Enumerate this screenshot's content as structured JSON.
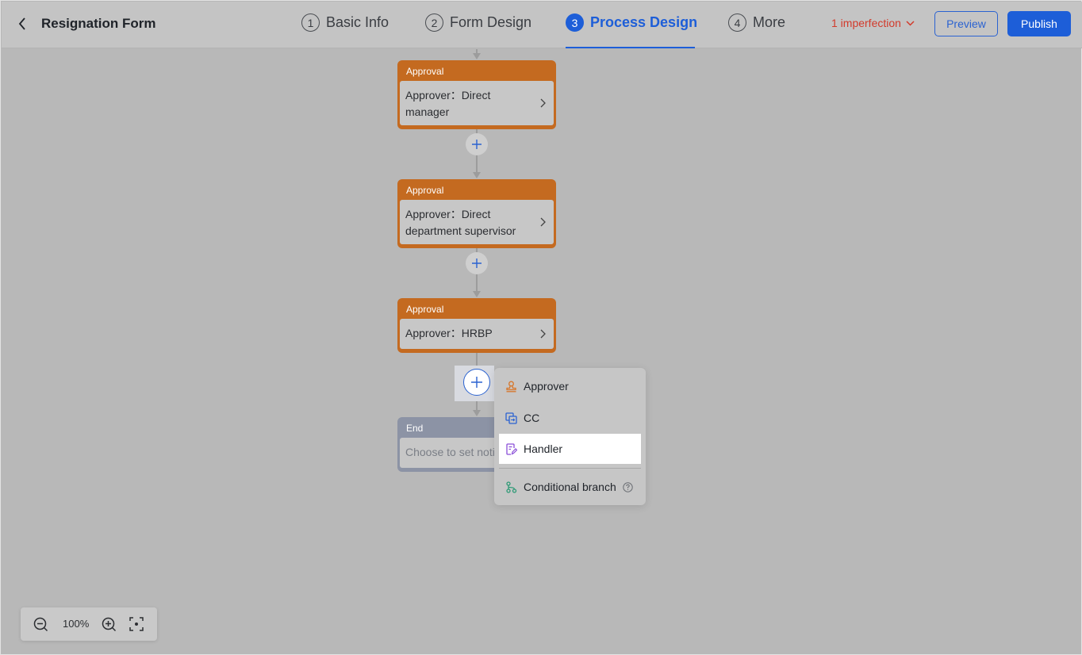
{
  "header": {
    "back_icon": "chevron-left-icon",
    "title": "Resignation Form",
    "steps": [
      {
        "num": "1",
        "label": "Basic Info",
        "active": false
      },
      {
        "num": "2",
        "label": "Form Design",
        "active": false
      },
      {
        "num": "3",
        "label": "Process Design",
        "active": true
      },
      {
        "num": "4",
        "label": "More",
        "active": false
      }
    ],
    "imperfection": "1 imperfection",
    "preview_label": "Preview",
    "publish_label": "Publish"
  },
  "flow": {
    "nodes": [
      {
        "type": "Approval",
        "text": "Approver：Direct manager"
      },
      {
        "type": "Approval",
        "text": "Approver：Direct department supervisor"
      },
      {
        "type": "Approval",
        "text": "Approver：HRBP"
      },
      {
        "type": "End",
        "text": "Choose to set notifier"
      }
    ]
  },
  "add_menu": {
    "items": [
      {
        "label": "Approver",
        "icon": "stamp-icon"
      },
      {
        "label": "CC",
        "icon": "cc-icon"
      },
      {
        "label": "Handler",
        "icon": "handler-edit-icon"
      }
    ],
    "conditional": "Conditional branch"
  },
  "zoom": {
    "level": "100%"
  },
  "colors": {
    "accent": "#1d5ed8",
    "approval_node": "#c46a20",
    "end_node": "#8c93a5",
    "warning": "#d23a2b"
  }
}
